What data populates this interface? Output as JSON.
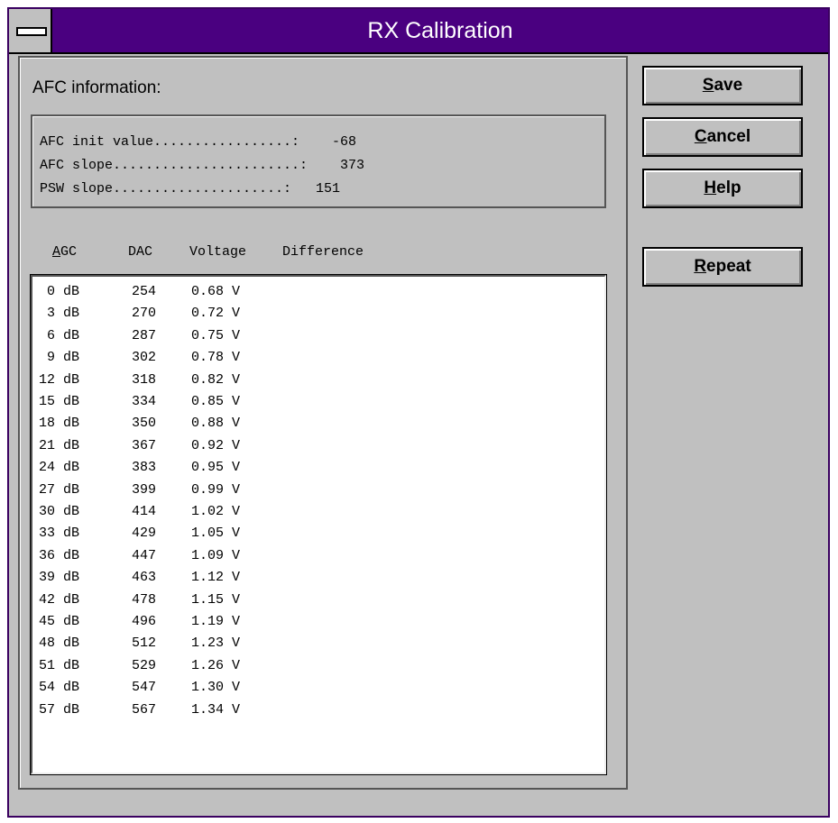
{
  "window": {
    "title": "RX Calibration"
  },
  "afc": {
    "header": "AFC information:",
    "lines": [
      "AFC init value.................:    -68",
      "AFC slope.......................:    373",
      "PSW slope.....................:   151"
    ]
  },
  "table": {
    "headers": {
      "agc_mnemonic": "A",
      "agc_rest": "GC",
      "dac": "DAC",
      "voltage": "Voltage",
      "difference": "Difference"
    },
    "rows": [
      {
        "agc": "0 dB",
        "dac": "254",
        "voltage": "0.68 V"
      },
      {
        "agc": "3 dB",
        "dac": "270",
        "voltage": "0.72 V"
      },
      {
        "agc": "6 dB",
        "dac": "287",
        "voltage": "0.75 V"
      },
      {
        "agc": "9 dB",
        "dac": "302",
        "voltage": "0.78 V"
      },
      {
        "agc": "12 dB",
        "dac": "318",
        "voltage": "0.82 V"
      },
      {
        "agc": "15 dB",
        "dac": "334",
        "voltage": "0.85 V"
      },
      {
        "agc": "18 dB",
        "dac": "350",
        "voltage": "0.88 V"
      },
      {
        "agc": "21 dB",
        "dac": "367",
        "voltage": "0.92 V"
      },
      {
        "agc": "24 dB",
        "dac": "383",
        "voltage": "0.95 V"
      },
      {
        "agc": "27 dB",
        "dac": "399",
        "voltage": "0.99 V"
      },
      {
        "agc": "30 dB",
        "dac": "414",
        "voltage": "1.02 V"
      },
      {
        "agc": "33 dB",
        "dac": "429",
        "voltage": "1.05 V"
      },
      {
        "agc": "36 dB",
        "dac": "447",
        "voltage": "1.09 V"
      },
      {
        "agc": "39 dB",
        "dac": "463",
        "voltage": "1.12 V"
      },
      {
        "agc": "42 dB",
        "dac": "478",
        "voltage": "1.15 V"
      },
      {
        "agc": "45 dB",
        "dac": "496",
        "voltage": "1.19 V"
      },
      {
        "agc": "48 dB",
        "dac": "512",
        "voltage": "1.23 V"
      },
      {
        "agc": "51 dB",
        "dac": "529",
        "voltage": "1.26 V"
      },
      {
        "agc": "54 dB",
        "dac": "547",
        "voltage": "1.30 V"
      },
      {
        "agc": "57 dB",
        "dac": "567",
        "voltage": "1.34 V"
      }
    ]
  },
  "buttons": {
    "save": {
      "mnemonic": "S",
      "rest": "ave"
    },
    "cancel": {
      "mnemonic": "C",
      "rest": "ancel"
    },
    "help": {
      "mnemonic": "H",
      "rest": "elp"
    },
    "repeat": {
      "mnemonic": "R",
      "rest": "epeat"
    }
  },
  "icons": {
    "system_menu": "system-menu-icon"
  },
  "colors": {
    "titlebar": "#4a0080",
    "face": "#c0c0c0"
  }
}
